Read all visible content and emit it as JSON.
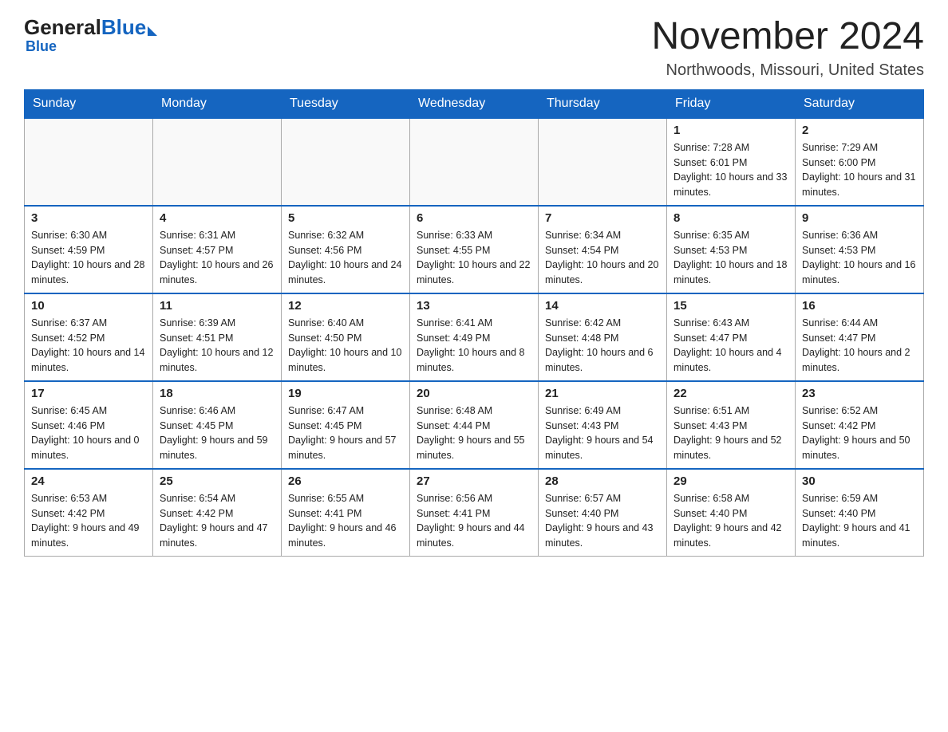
{
  "header": {
    "logo_general": "General",
    "logo_blue": "Blue",
    "month_title": "November 2024",
    "location": "Northwoods, Missouri, United States"
  },
  "weekdays": [
    "Sunday",
    "Monday",
    "Tuesday",
    "Wednesday",
    "Thursday",
    "Friday",
    "Saturday"
  ],
  "weeks": [
    [
      {
        "day": "",
        "sunrise": "",
        "sunset": "",
        "daylight": "",
        "empty": true
      },
      {
        "day": "",
        "sunrise": "",
        "sunset": "",
        "daylight": "",
        "empty": true
      },
      {
        "day": "",
        "sunrise": "",
        "sunset": "",
        "daylight": "",
        "empty": true
      },
      {
        "day": "",
        "sunrise": "",
        "sunset": "",
        "daylight": "",
        "empty": true
      },
      {
        "day": "",
        "sunrise": "",
        "sunset": "",
        "daylight": "",
        "empty": true
      },
      {
        "day": "1",
        "sunrise": "Sunrise: 7:28 AM",
        "sunset": "Sunset: 6:01 PM",
        "daylight": "Daylight: 10 hours and 33 minutes.",
        "empty": false
      },
      {
        "day": "2",
        "sunrise": "Sunrise: 7:29 AM",
        "sunset": "Sunset: 6:00 PM",
        "daylight": "Daylight: 10 hours and 31 minutes.",
        "empty": false
      }
    ],
    [
      {
        "day": "3",
        "sunrise": "Sunrise: 6:30 AM",
        "sunset": "Sunset: 4:59 PM",
        "daylight": "Daylight: 10 hours and 28 minutes.",
        "empty": false
      },
      {
        "day": "4",
        "sunrise": "Sunrise: 6:31 AM",
        "sunset": "Sunset: 4:57 PM",
        "daylight": "Daylight: 10 hours and 26 minutes.",
        "empty": false
      },
      {
        "day": "5",
        "sunrise": "Sunrise: 6:32 AM",
        "sunset": "Sunset: 4:56 PM",
        "daylight": "Daylight: 10 hours and 24 minutes.",
        "empty": false
      },
      {
        "day": "6",
        "sunrise": "Sunrise: 6:33 AM",
        "sunset": "Sunset: 4:55 PM",
        "daylight": "Daylight: 10 hours and 22 minutes.",
        "empty": false
      },
      {
        "day": "7",
        "sunrise": "Sunrise: 6:34 AM",
        "sunset": "Sunset: 4:54 PM",
        "daylight": "Daylight: 10 hours and 20 minutes.",
        "empty": false
      },
      {
        "day": "8",
        "sunrise": "Sunrise: 6:35 AM",
        "sunset": "Sunset: 4:53 PM",
        "daylight": "Daylight: 10 hours and 18 minutes.",
        "empty": false
      },
      {
        "day": "9",
        "sunrise": "Sunrise: 6:36 AM",
        "sunset": "Sunset: 4:53 PM",
        "daylight": "Daylight: 10 hours and 16 minutes.",
        "empty": false
      }
    ],
    [
      {
        "day": "10",
        "sunrise": "Sunrise: 6:37 AM",
        "sunset": "Sunset: 4:52 PM",
        "daylight": "Daylight: 10 hours and 14 minutes.",
        "empty": false
      },
      {
        "day": "11",
        "sunrise": "Sunrise: 6:39 AM",
        "sunset": "Sunset: 4:51 PM",
        "daylight": "Daylight: 10 hours and 12 minutes.",
        "empty": false
      },
      {
        "day": "12",
        "sunrise": "Sunrise: 6:40 AM",
        "sunset": "Sunset: 4:50 PM",
        "daylight": "Daylight: 10 hours and 10 minutes.",
        "empty": false
      },
      {
        "day": "13",
        "sunrise": "Sunrise: 6:41 AM",
        "sunset": "Sunset: 4:49 PM",
        "daylight": "Daylight: 10 hours and 8 minutes.",
        "empty": false
      },
      {
        "day": "14",
        "sunrise": "Sunrise: 6:42 AM",
        "sunset": "Sunset: 4:48 PM",
        "daylight": "Daylight: 10 hours and 6 minutes.",
        "empty": false
      },
      {
        "day": "15",
        "sunrise": "Sunrise: 6:43 AM",
        "sunset": "Sunset: 4:47 PM",
        "daylight": "Daylight: 10 hours and 4 minutes.",
        "empty": false
      },
      {
        "day": "16",
        "sunrise": "Sunrise: 6:44 AM",
        "sunset": "Sunset: 4:47 PM",
        "daylight": "Daylight: 10 hours and 2 minutes.",
        "empty": false
      }
    ],
    [
      {
        "day": "17",
        "sunrise": "Sunrise: 6:45 AM",
        "sunset": "Sunset: 4:46 PM",
        "daylight": "Daylight: 10 hours and 0 minutes.",
        "empty": false
      },
      {
        "day": "18",
        "sunrise": "Sunrise: 6:46 AM",
        "sunset": "Sunset: 4:45 PM",
        "daylight": "Daylight: 9 hours and 59 minutes.",
        "empty": false
      },
      {
        "day": "19",
        "sunrise": "Sunrise: 6:47 AM",
        "sunset": "Sunset: 4:45 PM",
        "daylight": "Daylight: 9 hours and 57 minutes.",
        "empty": false
      },
      {
        "day": "20",
        "sunrise": "Sunrise: 6:48 AM",
        "sunset": "Sunset: 4:44 PM",
        "daylight": "Daylight: 9 hours and 55 minutes.",
        "empty": false
      },
      {
        "day": "21",
        "sunrise": "Sunrise: 6:49 AM",
        "sunset": "Sunset: 4:43 PM",
        "daylight": "Daylight: 9 hours and 54 minutes.",
        "empty": false
      },
      {
        "day": "22",
        "sunrise": "Sunrise: 6:51 AM",
        "sunset": "Sunset: 4:43 PM",
        "daylight": "Daylight: 9 hours and 52 minutes.",
        "empty": false
      },
      {
        "day": "23",
        "sunrise": "Sunrise: 6:52 AM",
        "sunset": "Sunset: 4:42 PM",
        "daylight": "Daylight: 9 hours and 50 minutes.",
        "empty": false
      }
    ],
    [
      {
        "day": "24",
        "sunrise": "Sunrise: 6:53 AM",
        "sunset": "Sunset: 4:42 PM",
        "daylight": "Daylight: 9 hours and 49 minutes.",
        "empty": false
      },
      {
        "day": "25",
        "sunrise": "Sunrise: 6:54 AM",
        "sunset": "Sunset: 4:42 PM",
        "daylight": "Daylight: 9 hours and 47 minutes.",
        "empty": false
      },
      {
        "day": "26",
        "sunrise": "Sunrise: 6:55 AM",
        "sunset": "Sunset: 4:41 PM",
        "daylight": "Daylight: 9 hours and 46 minutes.",
        "empty": false
      },
      {
        "day": "27",
        "sunrise": "Sunrise: 6:56 AM",
        "sunset": "Sunset: 4:41 PM",
        "daylight": "Daylight: 9 hours and 44 minutes.",
        "empty": false
      },
      {
        "day": "28",
        "sunrise": "Sunrise: 6:57 AM",
        "sunset": "Sunset: 4:40 PM",
        "daylight": "Daylight: 9 hours and 43 minutes.",
        "empty": false
      },
      {
        "day": "29",
        "sunrise": "Sunrise: 6:58 AM",
        "sunset": "Sunset: 4:40 PM",
        "daylight": "Daylight: 9 hours and 42 minutes.",
        "empty": false
      },
      {
        "day": "30",
        "sunrise": "Sunrise: 6:59 AM",
        "sunset": "Sunset: 4:40 PM",
        "daylight": "Daylight: 9 hours and 41 minutes.",
        "empty": false
      }
    ]
  ]
}
